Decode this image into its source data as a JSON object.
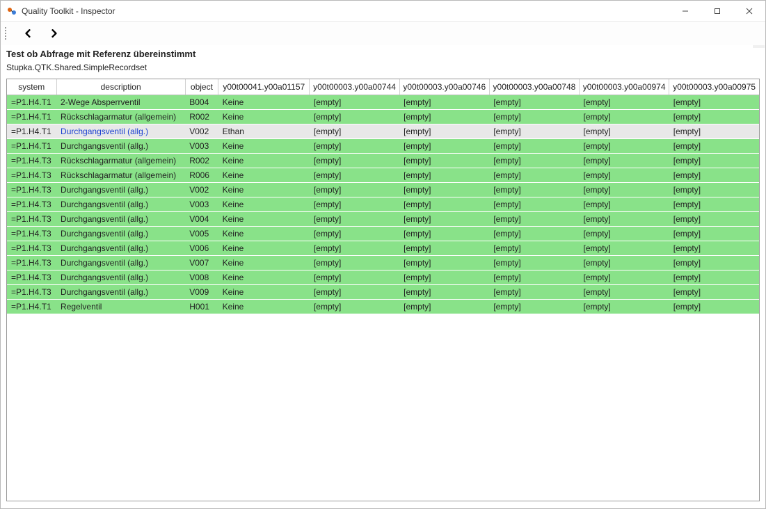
{
  "window": {
    "title": "Quality Toolkit - Inspector"
  },
  "heading": {
    "title": "Test ob Abfrage mit Referenz übereinstimmt",
    "subtitle": "Stupka.QTK.Shared.SimpleRecordset"
  },
  "table": {
    "columns": [
      "system",
      "description",
      "object",
      "y00t00041.y00a01157",
      "y00t00003.y00a00744",
      "y00t00003.y00a00746",
      "y00t00003.y00a00748",
      "y00t00003.y00a00974",
      "y00t00003.y00a00975"
    ],
    "rows": [
      {
        "status": "pass",
        "cells": [
          "=P1.H4.T1",
          "2-Wege Absperrventil",
          "B004",
          "Keine",
          "[empty]",
          "[empty]",
          "[empty]",
          "[empty]",
          "[empty]"
        ]
      },
      {
        "status": "pass",
        "cells": [
          "=P1.H4.T1",
          "Rückschlagarmatur (allgemein)",
          "R002",
          "Keine",
          "[empty]",
          "[empty]",
          "[empty]",
          "[empty]",
          "[empty]"
        ]
      },
      {
        "status": "diff",
        "cells": [
          "=P1.H4.T1",
          "Durchgangsventil (allg.)",
          "V002",
          "Ethan",
          "[empty]",
          "[empty]",
          "[empty]",
          "[empty]",
          "[empty]"
        ]
      },
      {
        "status": "pass",
        "cells": [
          "=P1.H4.T1",
          "Durchgangsventil (allg.)",
          "V003",
          "Keine",
          "[empty]",
          "[empty]",
          "[empty]",
          "[empty]",
          "[empty]"
        ]
      },
      {
        "status": "pass",
        "cells": [
          "=P1.H4.T3",
          "Rückschlagarmatur (allgemein)",
          "R002",
          "Keine",
          "[empty]",
          "[empty]",
          "[empty]",
          "[empty]",
          "[empty]"
        ]
      },
      {
        "status": "pass",
        "cells": [
          "=P1.H4.T3",
          "Rückschlagarmatur (allgemein)",
          "R006",
          "Keine",
          "[empty]",
          "[empty]",
          "[empty]",
          "[empty]",
          "[empty]"
        ]
      },
      {
        "status": "pass",
        "cells": [
          "=P1.H4.T3",
          "Durchgangsventil (allg.)",
          "V002",
          "Keine",
          "[empty]",
          "[empty]",
          "[empty]",
          "[empty]",
          "[empty]"
        ]
      },
      {
        "status": "pass",
        "cells": [
          "=P1.H4.T3",
          "Durchgangsventil (allg.)",
          "V003",
          "Keine",
          "[empty]",
          "[empty]",
          "[empty]",
          "[empty]",
          "[empty]"
        ]
      },
      {
        "status": "pass",
        "cells": [
          "=P1.H4.T3",
          "Durchgangsventil (allg.)",
          "V004",
          "Keine",
          "[empty]",
          "[empty]",
          "[empty]",
          "[empty]",
          "[empty]"
        ]
      },
      {
        "status": "pass",
        "cells": [
          "=P1.H4.T3",
          "Durchgangsventil (allg.)",
          "V005",
          "Keine",
          "[empty]",
          "[empty]",
          "[empty]",
          "[empty]",
          "[empty]"
        ]
      },
      {
        "status": "pass",
        "cells": [
          "=P1.H4.T3",
          "Durchgangsventil (allg.)",
          "V006",
          "Keine",
          "[empty]",
          "[empty]",
          "[empty]",
          "[empty]",
          "[empty]"
        ]
      },
      {
        "status": "pass",
        "cells": [
          "=P1.H4.T3",
          "Durchgangsventil (allg.)",
          "V007",
          "Keine",
          "[empty]",
          "[empty]",
          "[empty]",
          "[empty]",
          "[empty]"
        ]
      },
      {
        "status": "pass",
        "cells": [
          "=P1.H4.T3",
          "Durchgangsventil (allg.)",
          "V008",
          "Keine",
          "[empty]",
          "[empty]",
          "[empty]",
          "[empty]",
          "[empty]"
        ]
      },
      {
        "status": "pass",
        "cells": [
          "=P1.H4.T3",
          "Durchgangsventil (allg.)",
          "V009",
          "Keine",
          "[empty]",
          "[empty]",
          "[empty]",
          "[empty]",
          "[empty]"
        ]
      },
      {
        "status": "pass",
        "cells": [
          "=P1.H4.T1",
          "Regelventil",
          "H001",
          "Keine",
          "[empty]",
          "[empty]",
          "[empty]",
          "[empty]",
          "[empty]"
        ]
      }
    ]
  }
}
